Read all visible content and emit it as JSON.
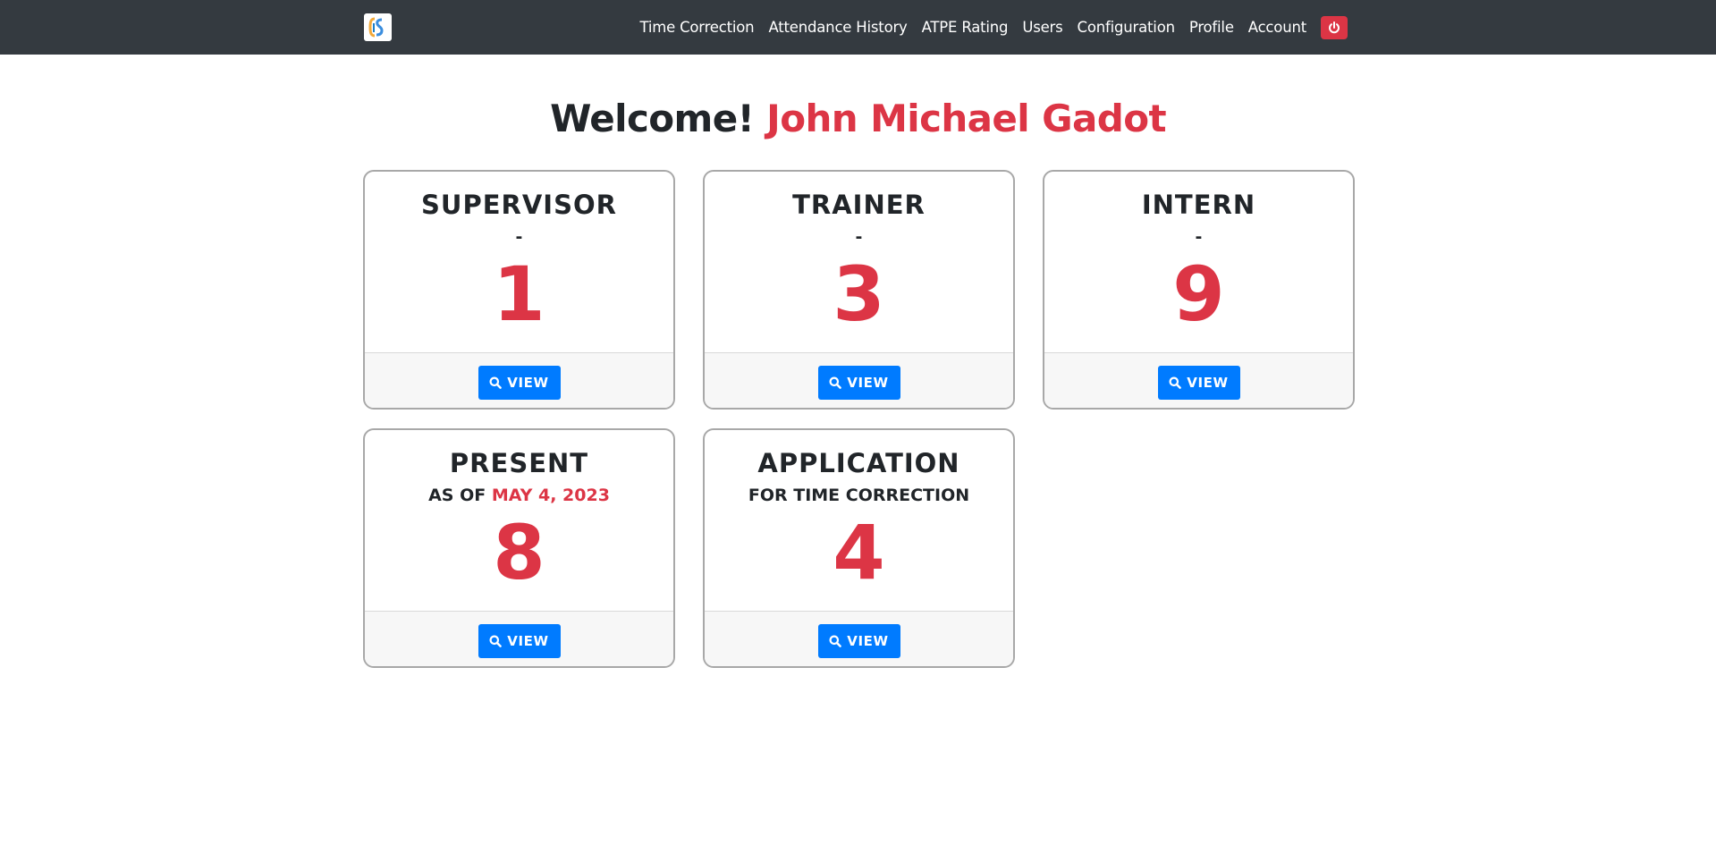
{
  "nav": {
    "links": [
      "Time Correction",
      "Attendance History",
      "ATPE Rating",
      "Users",
      "Configuration",
      "Profile",
      "Account"
    ],
    "logout_icon": "power-icon",
    "brand_icon": "company-logo"
  },
  "welcome": {
    "greeting": "Welcome!",
    "user_name": "John Michael Gadot"
  },
  "cards": [
    {
      "title": "SUPERVISOR",
      "subtitle": "-",
      "subtitle_accent": "",
      "count": "1",
      "button": "VIEW"
    },
    {
      "title": "TRAINER",
      "subtitle": "-",
      "subtitle_accent": "",
      "count": "3",
      "button": "VIEW"
    },
    {
      "title": "INTERN",
      "subtitle": "-",
      "subtitle_accent": "",
      "count": "9",
      "button": "VIEW"
    },
    {
      "title": "PRESENT",
      "subtitle": "AS OF ",
      "subtitle_accent": "MAY 4, 2023",
      "count": "8",
      "button": "VIEW"
    },
    {
      "title": "APPLICATION",
      "subtitle": "FOR TIME CORRECTION",
      "subtitle_accent": "",
      "count": "4",
      "button": "VIEW"
    }
  ],
  "colors": {
    "navbar": "#343a40",
    "accent_red": "#dc3545",
    "button_blue": "#007bff",
    "footer_bg": "#f7f7f7"
  }
}
